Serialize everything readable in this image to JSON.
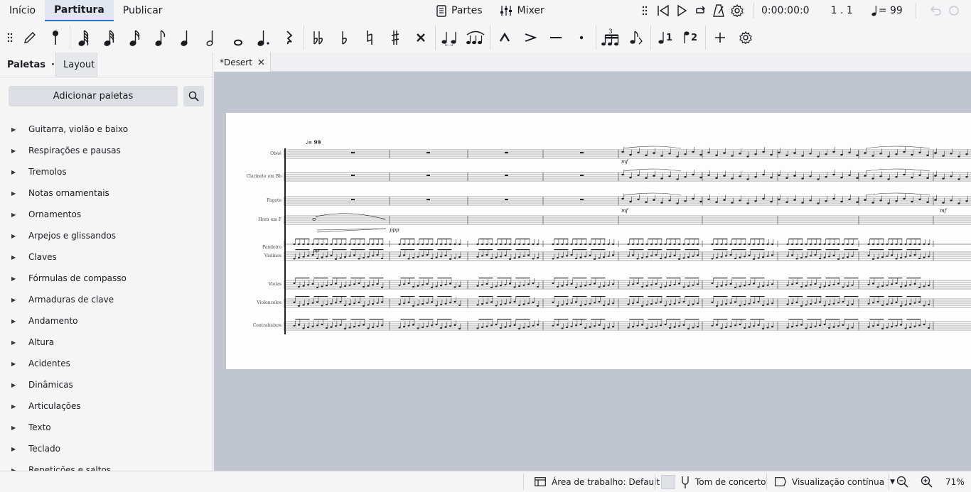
{
  "menu": {
    "tabs": [
      "Início",
      "Partitura",
      "Publicar"
    ],
    "active": "Partitura"
  },
  "top_center": {
    "parts_label": "Partes",
    "mixer_label": "Mixer"
  },
  "playback": {
    "time": "0:00:00:0",
    "position": "1 . 1",
    "tempo": "= 99"
  },
  "toolbar": {
    "tools": [
      "drag-handle-icon",
      "pen-icon",
      "input-mode-icon",
      "note-64th-icon",
      "note-32nd-icon",
      "note-16th-icon",
      "note-eighth-icon",
      "note-quarter-icon",
      "note-half-icon",
      "note-whole-icon",
      "augmentation-dot-icon",
      "rest-icon",
      "double-flat-icon",
      "flat-icon",
      "natural-icon",
      "sharp-icon",
      "double-sharp-icon",
      "tie-icon",
      "slur-icon",
      "accent-icon",
      "marcato-icon",
      "tenuto-icon",
      "staccato-icon",
      "tuplet-icon",
      "flip-direction-icon",
      "voice-1-icon",
      "voice-2-icon",
      "add-icon",
      "customize-toolbar-icon"
    ]
  },
  "sidebar": {
    "tabs": [
      "Paletas",
      "Layout"
    ],
    "more": "···",
    "add_palettes": "Adicionar paletas",
    "items": [
      "Guitarra, violão e baixo",
      "Respirações e pausas",
      "Tremolos",
      "Notas ornamentais",
      "Ornamentos",
      "Arpejos e glissandos",
      "Claves",
      "Fórmulas de compasso",
      "Armaduras de clave",
      "Andamento",
      "Altura",
      "Acidentes",
      "Dinâmicas",
      "Articulações",
      "Texto",
      "Teclado",
      "Repetições e saltos"
    ]
  },
  "document": {
    "tab": "*Desert",
    "score": {
      "tempo_mark": "= 99",
      "instruments": [
        "Oboé",
        "Clarinete em Bb",
        "Fagote",
        "Horn em F",
        "Pandeiro",
        "Violinos",
        "Violas",
        "Violoncelos",
        "Contrabaixos"
      ],
      "dynamics": [
        "mf",
        "ppp",
        "pp"
      ]
    }
  },
  "status": {
    "workspace": "Área de trabalho: Default",
    "concert_pitch": "Tom de concerto",
    "view_mode": "Visualização contínua",
    "zoom": "71%"
  }
}
